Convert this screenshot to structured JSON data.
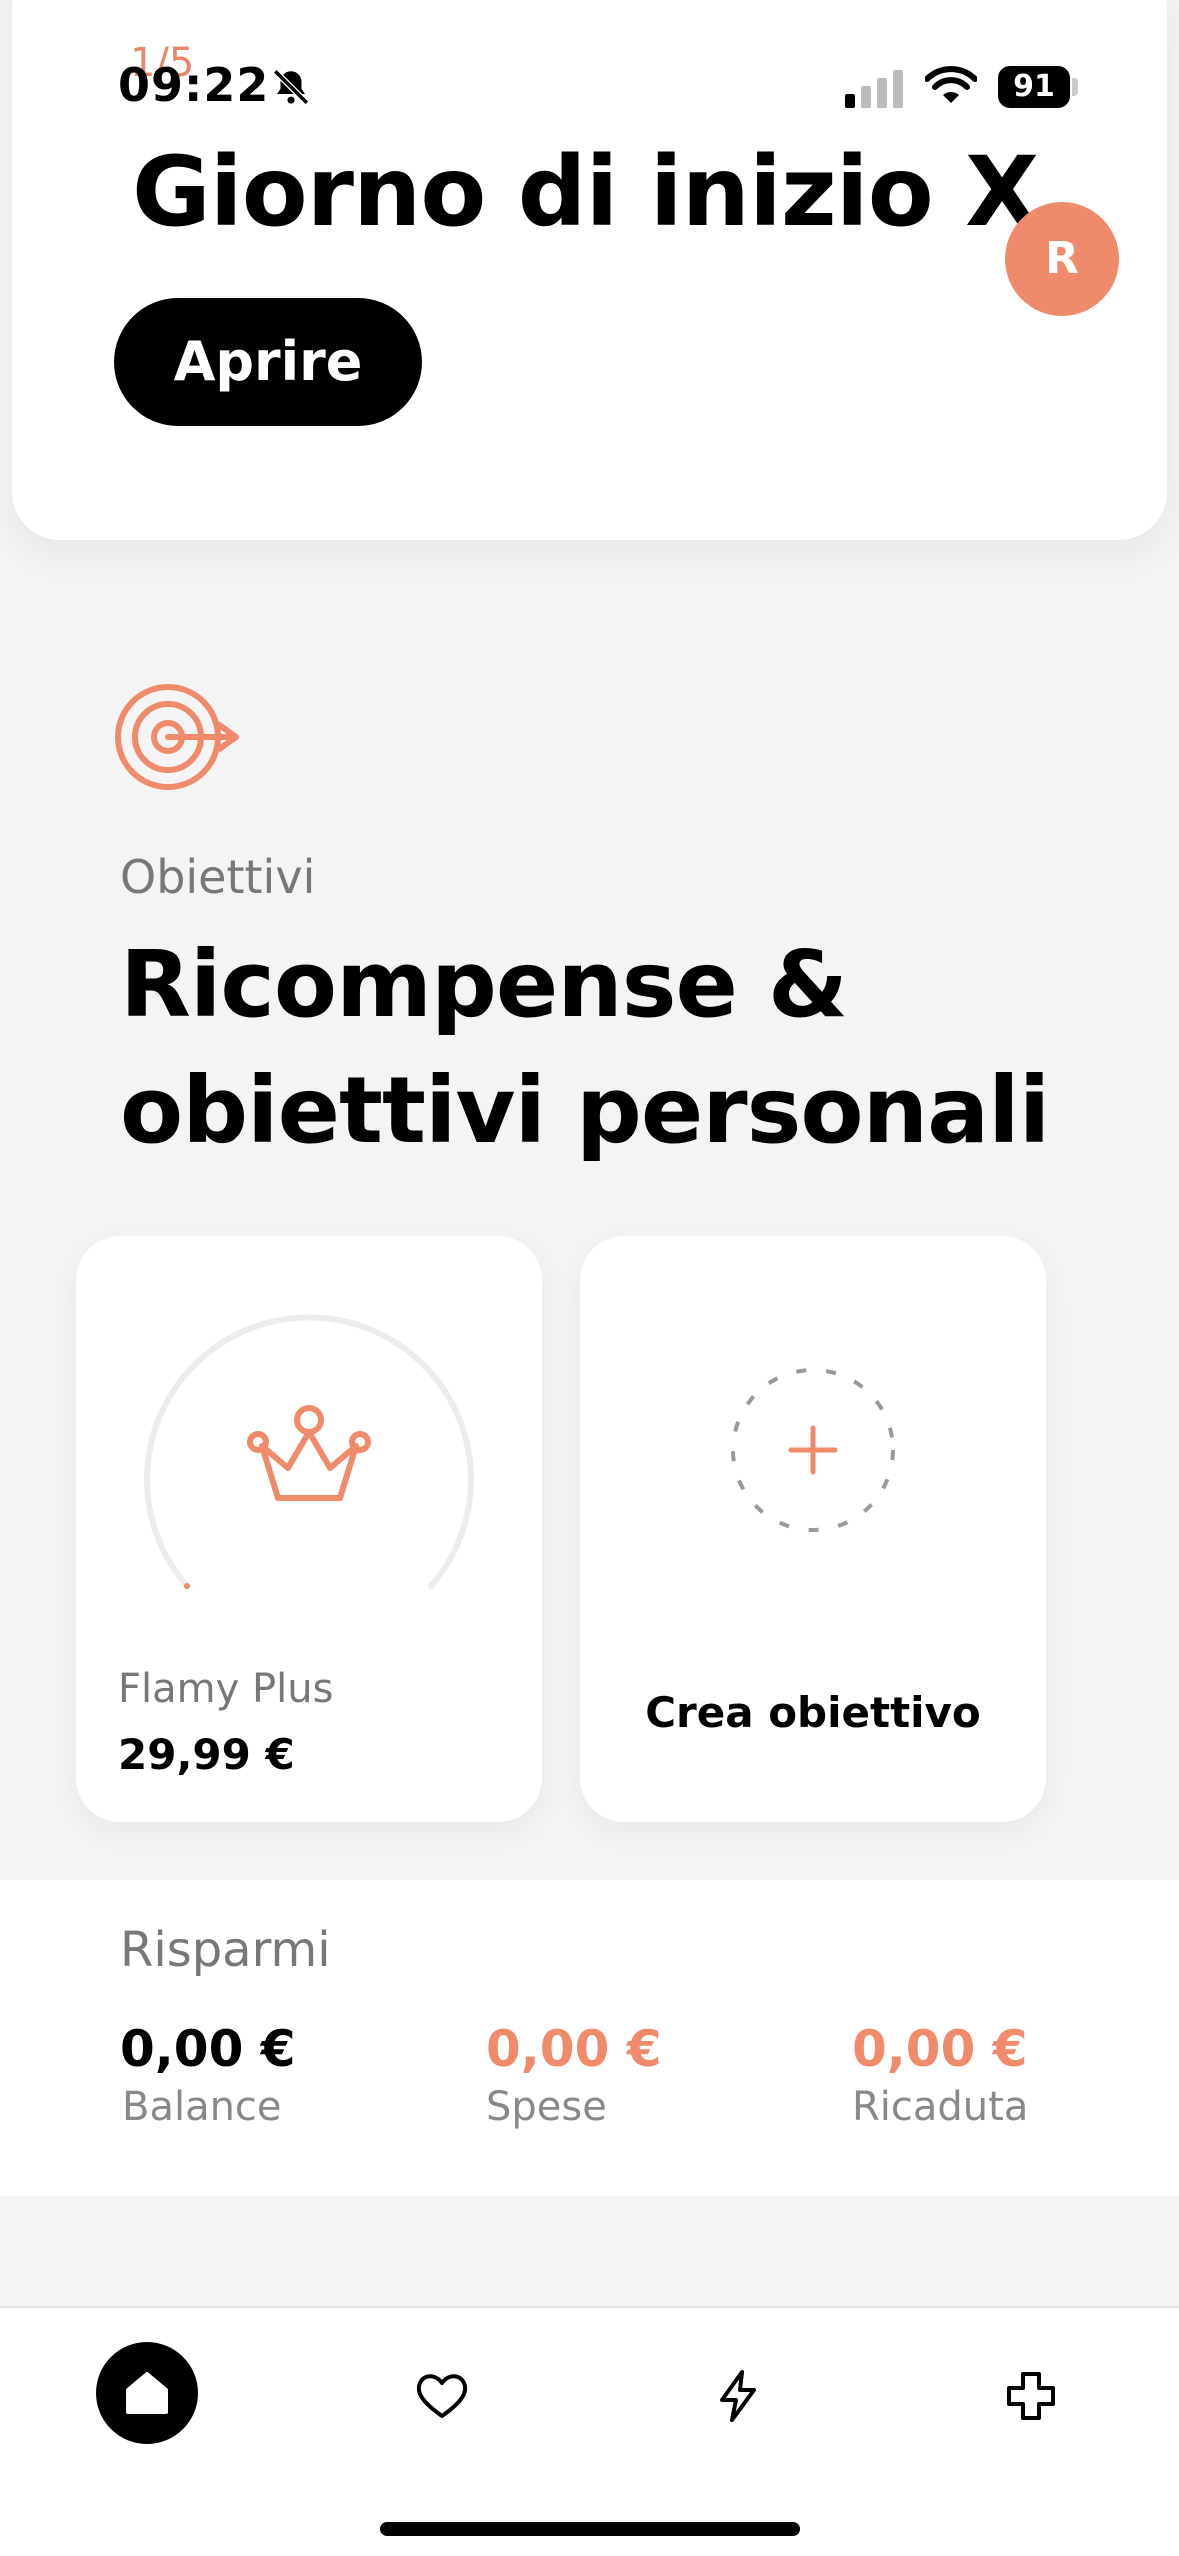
{
  "status_bar": {
    "time": "09:22",
    "battery": "91"
  },
  "top_card": {
    "step": "1/5",
    "title": "Giorno di inizio X",
    "avatar_initial": "R",
    "open_button": "Aprire"
  },
  "goals": {
    "label": "Obiettivi",
    "heading_line1": "Ricompense &",
    "heading_line2": "obiettivi personali",
    "cards": [
      {
        "name": "Flamy Plus",
        "price": "29,99 €",
        "progress": 0
      },
      {
        "create_label": "Crea obiettivo"
      }
    ]
  },
  "savings": {
    "title": "Risparmi",
    "items": [
      {
        "value": "0,00 €",
        "label": "Balance"
      },
      {
        "value": "0,00 €",
        "label": "Spese"
      },
      {
        "value": "0,00 €",
        "label": "Ricaduta"
      }
    ]
  },
  "nav": {
    "items": [
      "home-icon",
      "heart-icon",
      "bolt-icon",
      "cross-icon"
    ],
    "active": "home-icon"
  },
  "colors": {
    "accent": "#ef8a6a",
    "text": "#000000",
    "muted": "#777777",
    "background": "#f4f4f4"
  }
}
